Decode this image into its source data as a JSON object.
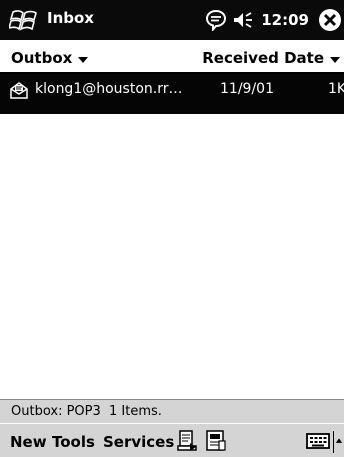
{
  "titlebar": {
    "start_icon": "windows-flag-icon",
    "title": "Inbox",
    "connectivity_icon": "speech-bubble-icon",
    "volume_icon": "speaker-icon",
    "time": "12:09",
    "close_icon": "close-x-icon"
  },
  "column_header": {
    "folder": "Outbox",
    "sort": "Received Date"
  },
  "messages": [
    {
      "icon": "outbox-message-icon",
      "from": "klong1@houston.rr…",
      "date": "11/9/01",
      "size": "1K",
      "selected": true
    }
  ],
  "status": {
    "text": "Outbox: POP3  1 Items."
  },
  "menubar": {
    "new": "New",
    "tools": "Tools",
    "services": "Services",
    "icons": [
      "send-receive-icon",
      "message-folder-icon"
    ],
    "keyboard_icon": "keyboard-icon",
    "sip_arrow_icon": "up-arrow-icon"
  },
  "colors": {
    "titlebar_bg": "#0a0a0a",
    "selection_bg": "#050505",
    "bar_bg": "#d4d4d4",
    "text": "#000000"
  }
}
